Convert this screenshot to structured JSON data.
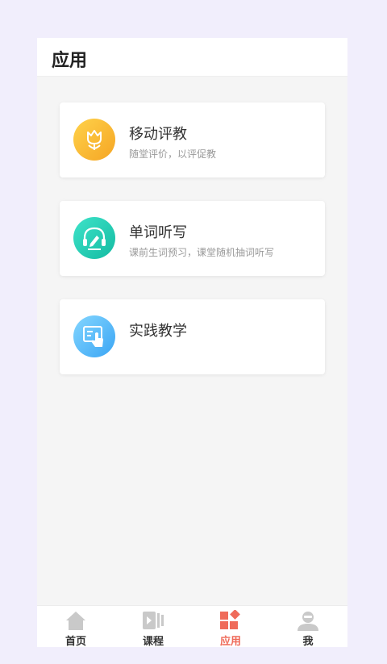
{
  "header": {
    "title": "应用"
  },
  "cards": [
    {
      "title": "移动评教",
      "subtitle": "随堂评价，以评促教",
      "icon": "tulip-icon",
      "gradient": [
        "#ffd24a",
        "#f6a92b"
      ]
    },
    {
      "title": "单词听写",
      "subtitle": "课前生词预习，课堂随机抽词听写",
      "icon": "headphones-pen-icon",
      "gradient": [
        "#3ee0c8",
        "#17c1a8"
      ]
    },
    {
      "title": "实践教学",
      "subtitle": "",
      "icon": "touch-screen-icon",
      "gradient": [
        "#7ad0ff",
        "#3ea7f5"
      ]
    }
  ],
  "tabs": [
    {
      "label": "首页",
      "icon": "home-icon"
    },
    {
      "label": "课程",
      "icon": "video-icon"
    },
    {
      "label": "应用",
      "icon": "apps-icon",
      "active": true
    },
    {
      "label": "我",
      "icon": "user-icon"
    }
  ],
  "colors": {
    "accent": "#ef6b5a",
    "inactive_icon": "#c9c9c9"
  }
}
